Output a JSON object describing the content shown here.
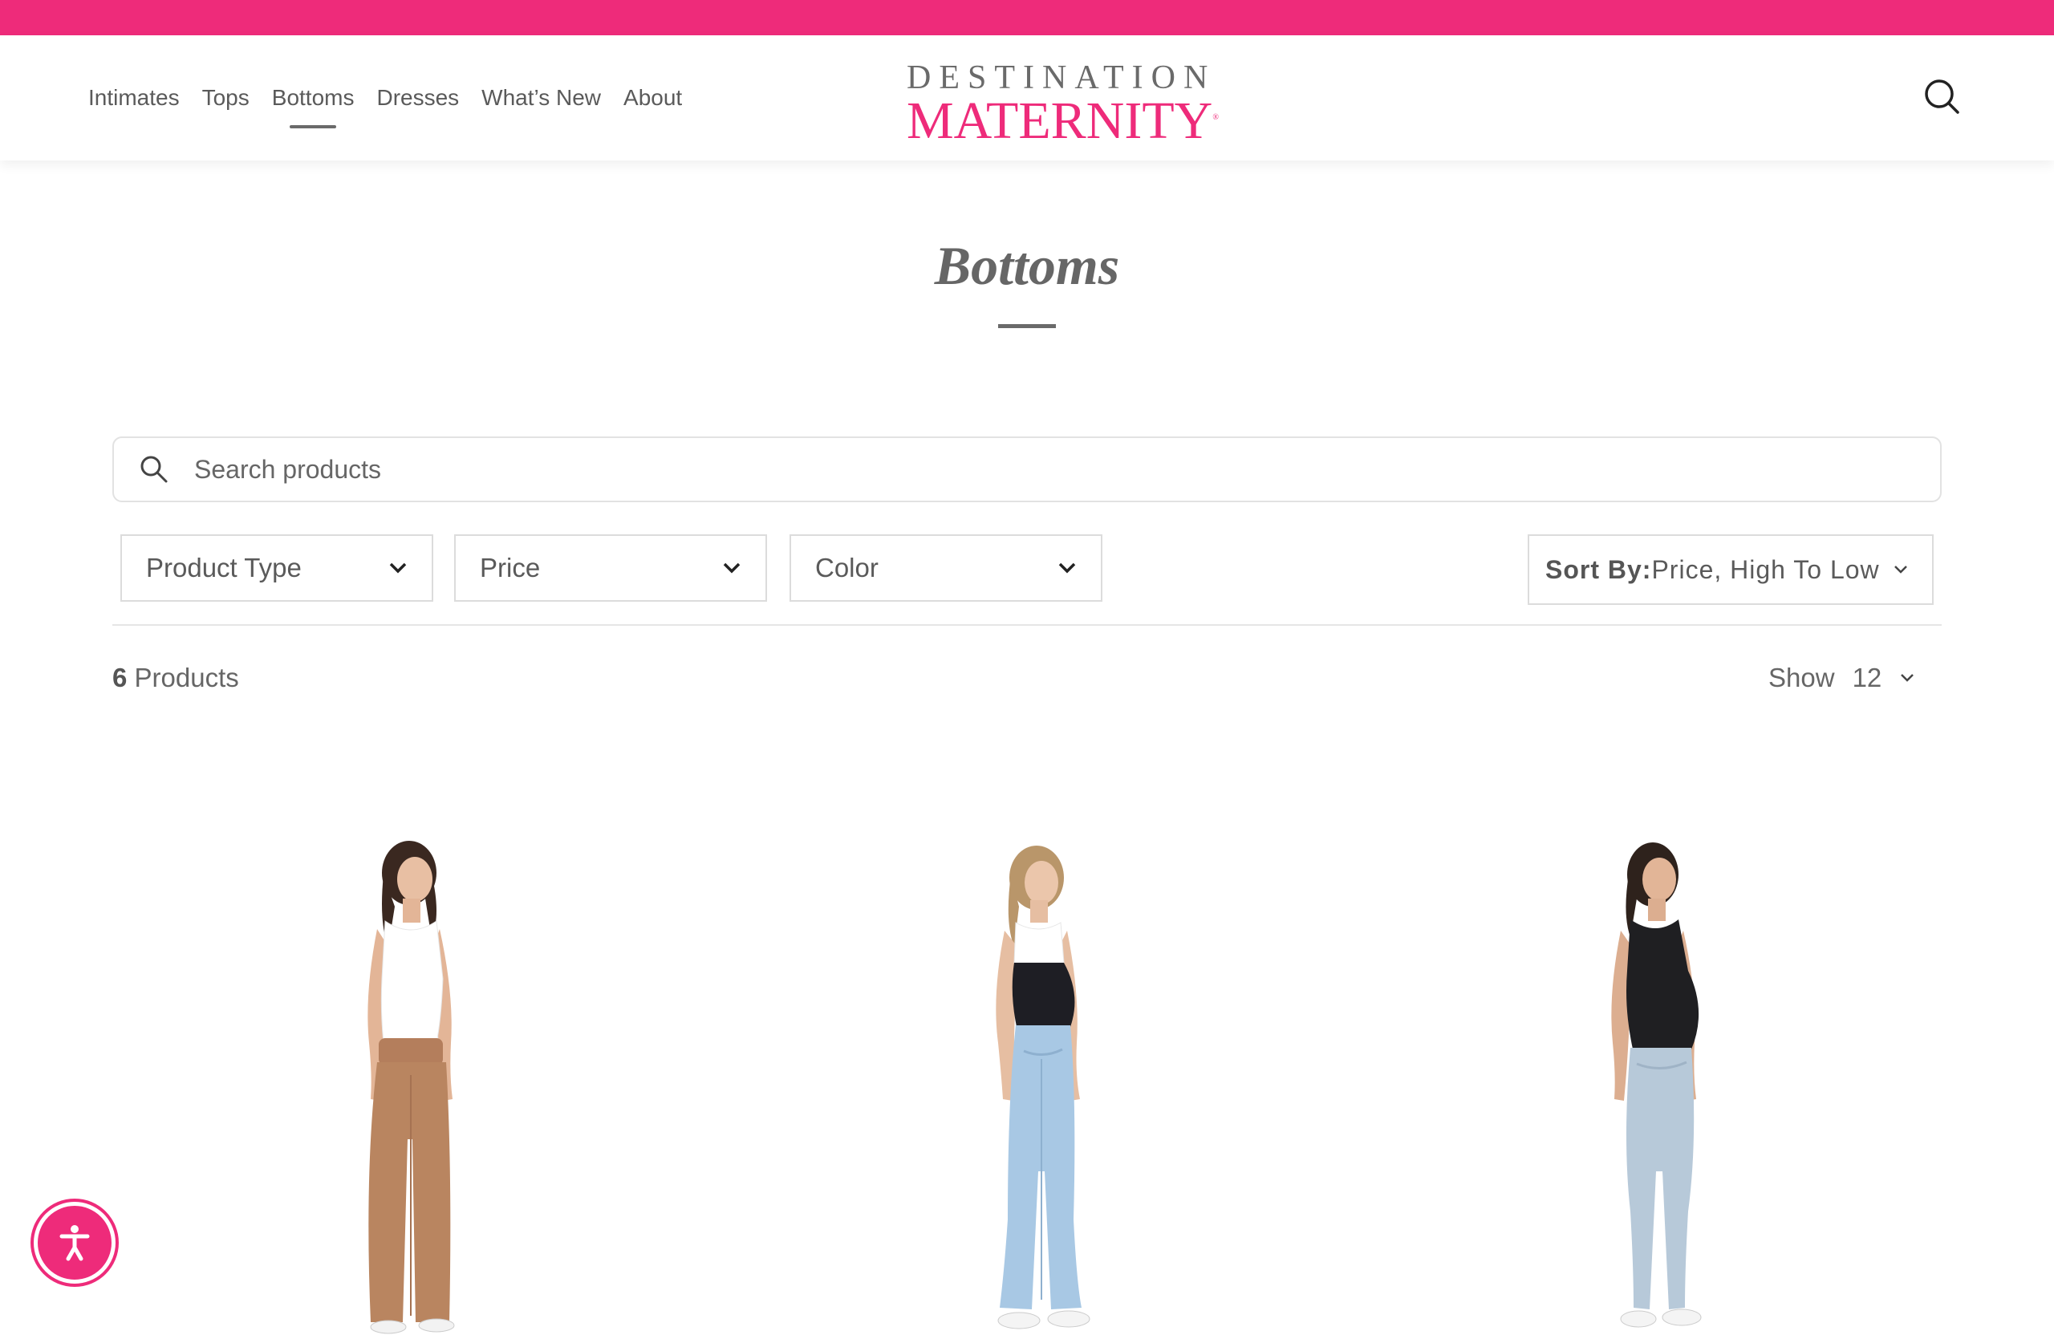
{
  "nav": {
    "items": [
      {
        "label": "Intimates"
      },
      {
        "label": "Tops"
      },
      {
        "label": "Bottoms",
        "active": true
      },
      {
        "label": "Dresses"
      },
      {
        "label": "What’s New"
      },
      {
        "label": "About"
      }
    ]
  },
  "logo": {
    "line1": "DESTINATION",
    "line2": "MATERNITY",
    "line2_mark": "®"
  },
  "page": {
    "title": "Bottoms"
  },
  "search": {
    "placeholder": "Search products",
    "value": ""
  },
  "filters": [
    {
      "label": "Product Type"
    },
    {
      "label": "Price"
    },
    {
      "label": "Color"
    }
  ],
  "sort": {
    "prefix": "Sort By:",
    "value": "Price, High To Low"
  },
  "results": {
    "count": "6",
    "count_label": "Products",
    "show_label": "Show",
    "show_value": "12"
  },
  "products": [
    {
      "image": "model in tan wide-leg pants and white tank"
    },
    {
      "image": "model in light-wash cropped flare jeans with black belly panel"
    },
    {
      "image": "model in light-wash skinny jeans with black cami"
    }
  ],
  "colors": {
    "brand_pink": "#ee2b7a",
    "text_gray": "#5a5a5a",
    "border": "#dcdcdc"
  },
  "icons": [
    "search-icon",
    "chevron-down-icon",
    "accessibility-icon"
  ]
}
